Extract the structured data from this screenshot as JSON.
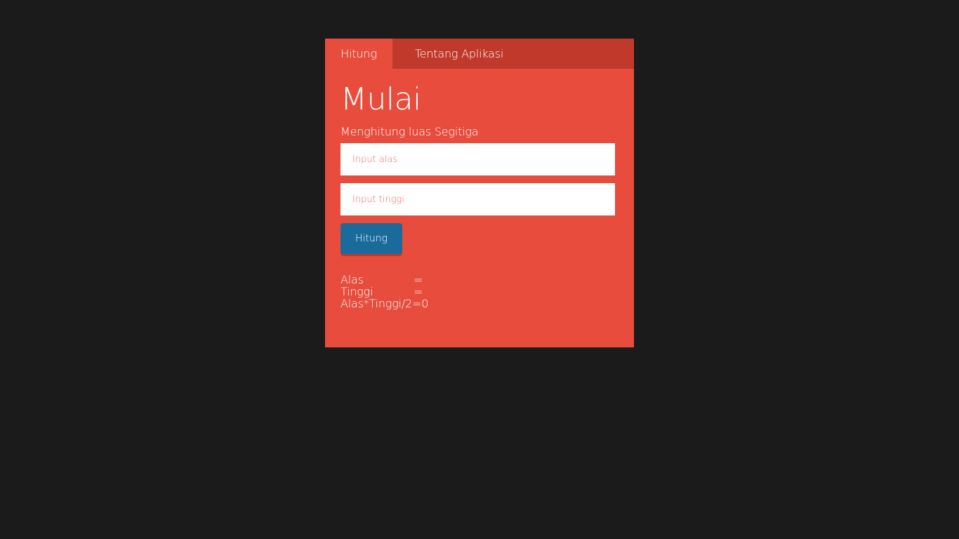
{
  "tabs": [
    {
      "label": "Hitung",
      "active": true
    },
    {
      "label": "Tentang Aplikasi",
      "active": false
    }
  ],
  "main": {
    "title": "Mulai",
    "subtitle": "Menghitung luas Segitiga",
    "alas_input": {
      "placeholder": "Input alas",
      "value": ""
    },
    "tinggi_input": {
      "placeholder": "Input tinggi",
      "value": ""
    },
    "button_label": "Hitung"
  },
  "results": {
    "alas_label": "Alas",
    "alas_value": "=",
    "tinggi_label": "Tinggi",
    "tinggi_value": "=",
    "formula": "Alas*Tinggi/2=0"
  },
  "colors": {
    "background": "#1b1b1b",
    "panel": "#e74c3c",
    "tabbar": "#c0392b",
    "button": "#1a6b9c"
  }
}
